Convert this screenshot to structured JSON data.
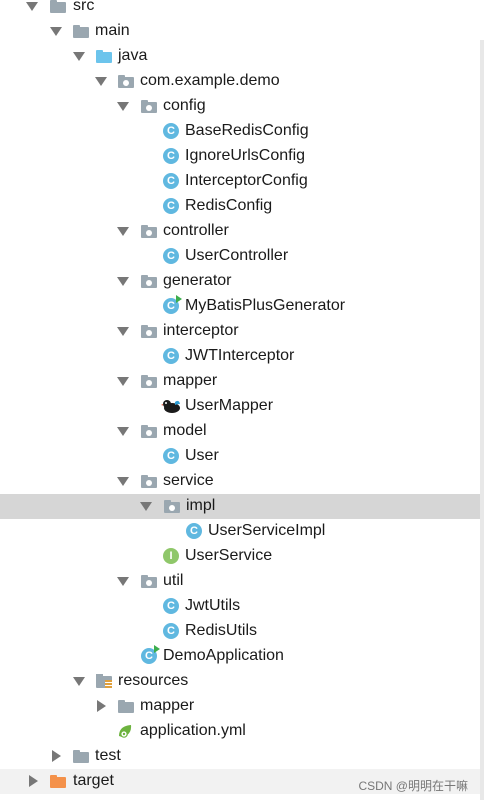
{
  "tree": {
    "src": "src",
    "main": "main",
    "java": "java",
    "package": "com.example.demo",
    "config": "config",
    "BaseRedisConfig": "BaseRedisConfig",
    "IgnoreUrlsConfig": "IgnoreUrlsConfig",
    "InterceptorConfig": "InterceptorConfig",
    "RedisConfig": "RedisConfig",
    "controller": "controller",
    "UserController": "UserController",
    "generator": "generator",
    "MyBatisPlusGenerator": "MyBatisPlusGenerator",
    "interceptor": "interceptor",
    "JWTInterceptor": "JWTInterceptor",
    "mapper": "mapper",
    "UserMapper": "UserMapper",
    "model": "model",
    "User": "User",
    "service": "service",
    "impl": "impl",
    "UserServiceImpl": "UserServiceImpl",
    "UserService": "UserService",
    "util": "util",
    "JwtUtils": "JwtUtils",
    "RedisUtils": "RedisUtils",
    "DemoApplication": "DemoApplication",
    "resources": "resources",
    "resMapper": "mapper",
    "applicationYml": "application.yml",
    "test": "test",
    "target": "target"
  },
  "icon_letters": {
    "class": "C",
    "interface": "I"
  },
  "watermark": "CSDN @明明在干嘛"
}
